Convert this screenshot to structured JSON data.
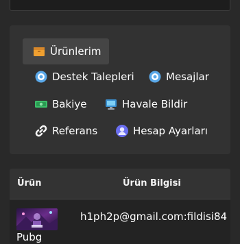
{
  "menu": {
    "products_label": "Ürünlerim",
    "support_label": "Destek Talepleri",
    "messages_label": "Mesajlar",
    "balance_label": "Bakiye",
    "transfer_label": "Havale Bildir",
    "referral_label": "Referans",
    "account_label": "Hesap Ayarları"
  },
  "table": {
    "headers": {
      "product": "Ürün",
      "info": "Ürün Bilgisi"
    },
    "rows": [
      {
        "name": "Pubg",
        "info": "h1ph2p@gmail.com:fildisi84"
      }
    ]
  },
  "icons": {
    "products": "package-icon",
    "support": "support-ticket-icon",
    "messages": "message-icon",
    "balance": "money-icon",
    "transfer": "monitor-icon",
    "referral": "link-icon",
    "account": "user-settings-icon"
  }
}
